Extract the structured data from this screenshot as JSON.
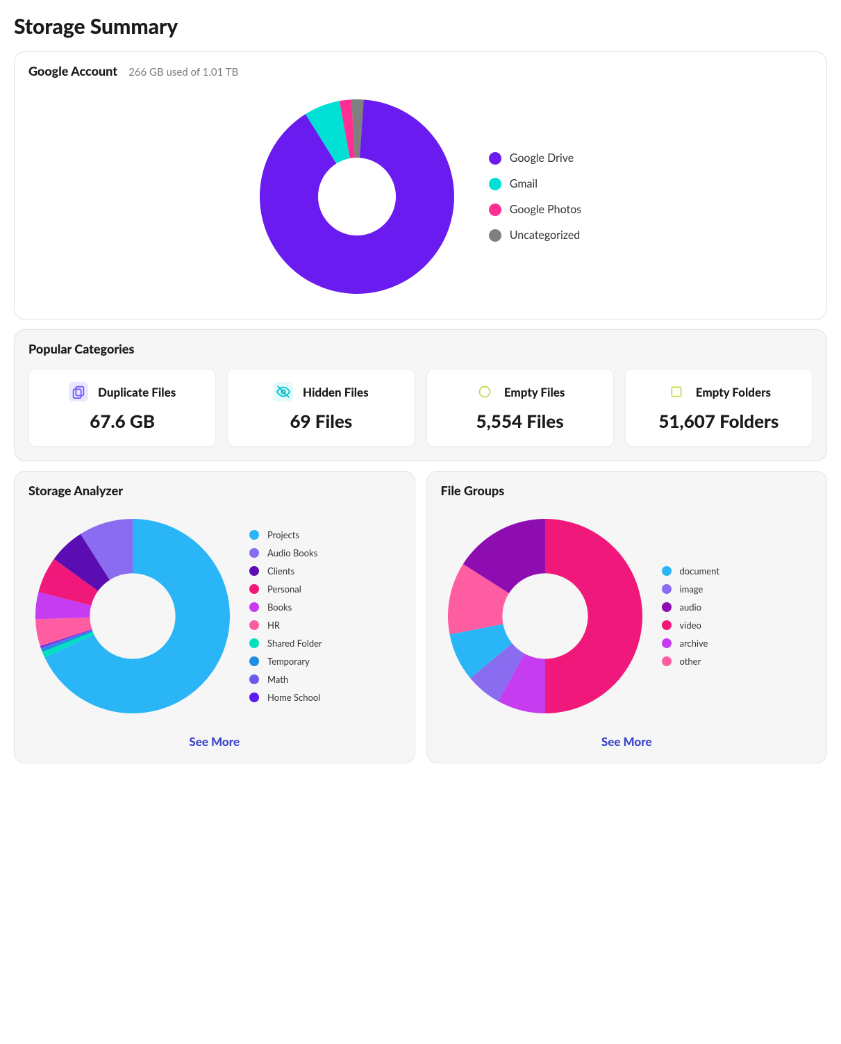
{
  "page_title": "Storage Summary",
  "account_card": {
    "title": "Google Account",
    "subtitle": "266 GB used of 1.01 TB"
  },
  "popular": {
    "title": "Popular Categories",
    "items": [
      {
        "name": "Duplicate Files",
        "value": "67.6 GB",
        "icon": "duplicate-icon",
        "color": "#6b5cff",
        "bg": "#eae7ff"
      },
      {
        "name": "Hidden Files",
        "value": "69 Files",
        "icon": "hidden-icon",
        "color": "#00c4cc",
        "bg": "#e3fbfc"
      },
      {
        "name": "Empty Files",
        "value": "5,554 Files",
        "icon": "empty-file-icon",
        "color": "#c6d63f",
        "bg": "transparent"
      },
      {
        "name": "Empty Folders",
        "value": "51,607 Folders",
        "icon": "empty-folder-icon",
        "color": "#c6d63f",
        "bg": "transparent"
      }
    ]
  },
  "analyzer": {
    "title": "Storage Analyzer",
    "see_more": "See More"
  },
  "groups": {
    "title": "File Groups",
    "see_more": "See More"
  },
  "chart_data": [
    {
      "id": "account",
      "type": "pie",
      "title": "Google Account storage breakdown",
      "series": [
        {
          "name": "Google Drive",
          "value": 90,
          "color": "#6a1cf0"
        },
        {
          "name": "Gmail",
          "value": 6,
          "color": "#00e0d5"
        },
        {
          "name": "Google Photos",
          "value": 2,
          "color": "#ff2e93"
        },
        {
          "name": "Uncategorized",
          "value": 2,
          "color": "#7f7f7f"
        }
      ]
    },
    {
      "id": "analyzer",
      "type": "pie",
      "title": "Storage Analyzer",
      "series": [
        {
          "name": "Projects",
          "value": 68,
          "color": "#2ab6f6"
        },
        {
          "name": "Audio Books",
          "value": 9,
          "color": "#8a6cf0"
        },
        {
          "name": "Clients",
          "value": 6,
          "color": "#5a0db0"
        },
        {
          "name": "Personal",
          "value": 6,
          "color": "#f0197b"
        },
        {
          "name": "Books",
          "value": 4.5,
          "color": "#c63cf0"
        },
        {
          "name": "HR",
          "value": 4.5,
          "color": "#ff5da2"
        },
        {
          "name": "Shared Folder",
          "value": 1,
          "color": "#00e0c0"
        },
        {
          "name": "Temporary",
          "value": 0.5,
          "color": "#1f8de0"
        },
        {
          "name": "Math",
          "value": 0.3,
          "color": "#6a5cf0"
        },
        {
          "name": "Home School",
          "value": 0.2,
          "color": "#5a1cf0"
        }
      ]
    },
    {
      "id": "groups",
      "type": "pie",
      "title": "File Groups",
      "series": [
        {
          "name": "document",
          "value": 8,
          "color": "#2ab6f6"
        },
        {
          "name": "image",
          "value": 6,
          "color": "#8a6cf0"
        },
        {
          "name": "audio",
          "value": 16,
          "color": "#8e0db0"
        },
        {
          "name": "video",
          "value": 50,
          "color": "#f0197b"
        },
        {
          "name": "archive",
          "value": 8,
          "color": "#c63cf0"
        },
        {
          "name": "other",
          "value": 12,
          "color": "#ff5da2"
        }
      ]
    }
  ]
}
